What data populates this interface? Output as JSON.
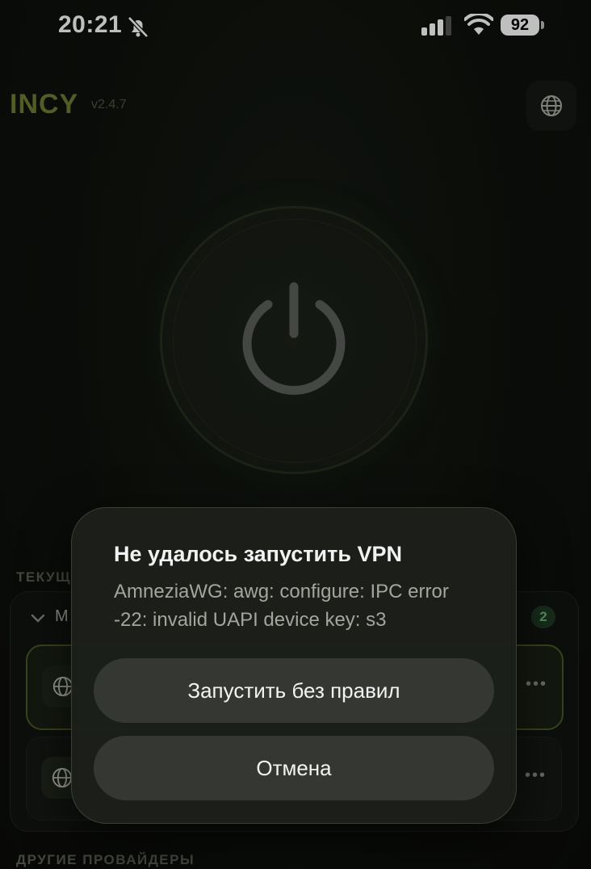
{
  "status_bar": {
    "time": "20:21",
    "battery": "92"
  },
  "header": {
    "app_name": "INCY",
    "version": "v2.4.7"
  },
  "sections": {
    "current_label": "ТЕКУЩ",
    "others_label": "ДРУГИЕ ПРОВАЙДЕРЫ"
  },
  "provider": {
    "title_initial": "M",
    "server_count": "2",
    "servers": [
      {
        "state": "active",
        "more": "•••"
      },
      {
        "state": "idle",
        "more": "•••"
      }
    ]
  },
  "dialog": {
    "title": "Не удалось запустить VPN",
    "message": "AmneziaWG: awg: configure: IPC error -22: invalid UAPI device key: s3",
    "primary_button": "Запустить без правил",
    "cancel_button": "Отмена"
  },
  "colors": {
    "accent": "#6f7a33",
    "badge_bg": "#1f3a24",
    "badge_text": "#6fbd7a"
  }
}
